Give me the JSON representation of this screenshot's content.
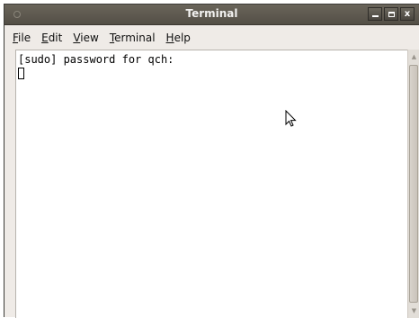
{
  "window": {
    "title": "Terminal"
  },
  "menu": {
    "file": {
      "mnemonic": "F",
      "rest": "ile"
    },
    "edit": {
      "mnemonic": "E",
      "rest": "dit"
    },
    "view": {
      "mnemonic": "V",
      "rest": "iew"
    },
    "terminal": {
      "mnemonic": "T",
      "rest": "erminal"
    },
    "help": {
      "mnemonic": "H",
      "rest": "elp"
    }
  },
  "terminal": {
    "line1": "[sudo] password for qch:"
  },
  "titlebar_buttons": {
    "close_glyph": "x"
  }
}
